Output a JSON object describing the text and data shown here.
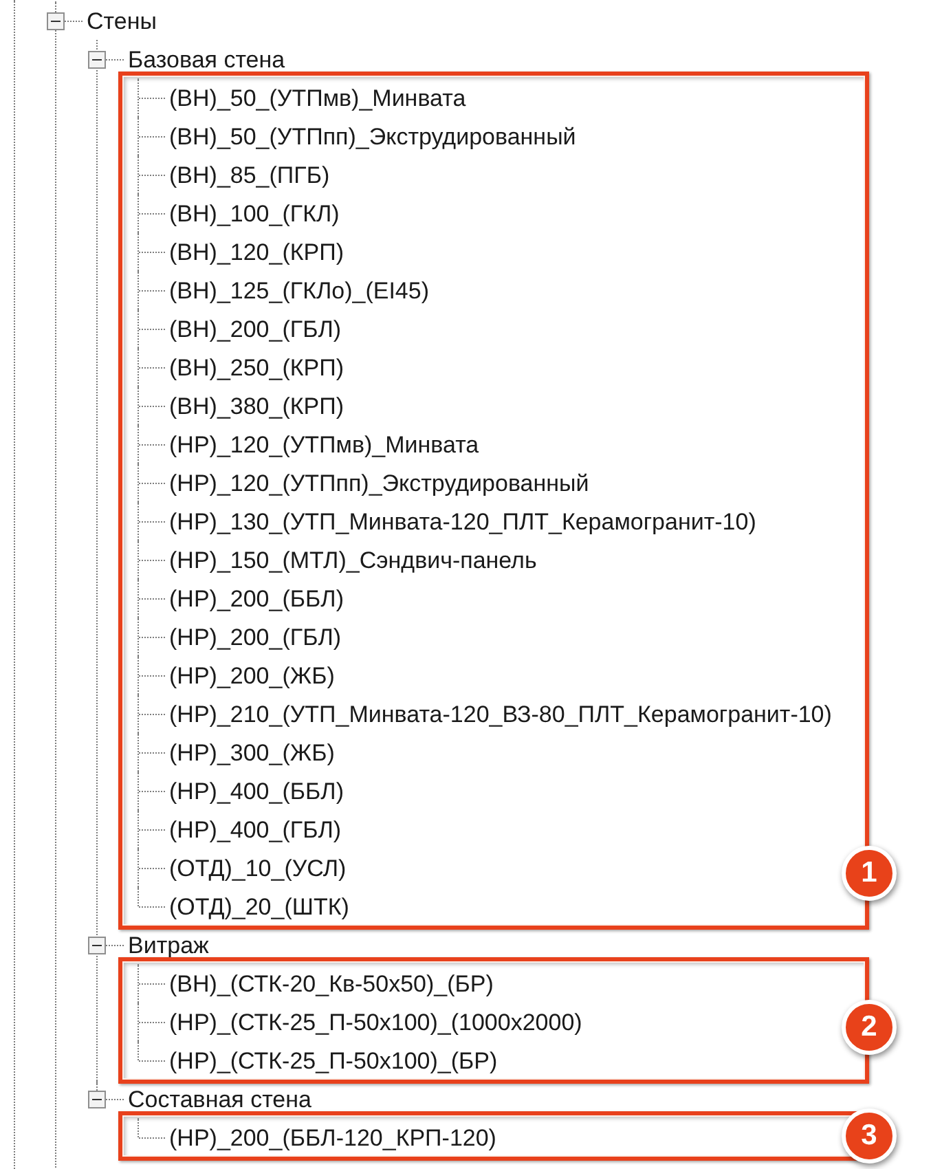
{
  "tree": [
    {
      "label": "Стены",
      "expanded": true,
      "children": [
        {
          "label": "Базовая стена",
          "expanded": true,
          "callout": "1",
          "children": [
            {
              "label": "(ВН)_50_(УТПмв)_Минвата"
            },
            {
              "label": "(ВН)_50_(УТПпп)_Экструдированный"
            },
            {
              "label": "(ВН)_85_(ПГБ)"
            },
            {
              "label": "(ВН)_100_(ГКЛ)"
            },
            {
              "label": "(ВН)_120_(КРП)"
            },
            {
              "label": "(ВН)_125_(ГКЛо)_(EI45)"
            },
            {
              "label": "(ВН)_200_(ГБЛ)"
            },
            {
              "label": "(ВН)_250_(КРП)"
            },
            {
              "label": "(ВН)_380_(КРП)"
            },
            {
              "label": "(НР)_120_(УТПмв)_Минвата"
            },
            {
              "label": "(НР)_120_(УТПпп)_Экструдированный"
            },
            {
              "label": "(НР)_130_(УТП_Минвата-120_ПЛТ_Керамогранит-10)"
            },
            {
              "label": "(НР)_150_(МТЛ)_Сэндвич-панель"
            },
            {
              "label": "(НР)_200_(ББЛ)"
            },
            {
              "label": "(НР)_200_(ГБЛ)"
            },
            {
              "label": "(НР)_200_(ЖБ)"
            },
            {
              "label": "(НР)_210_(УТП_Минвата-120_ВЗ-80_ПЛТ_Керамогранит-10)"
            },
            {
              "label": "(НР)_300_(ЖБ)"
            },
            {
              "label": "(НР)_400_(ББЛ)"
            },
            {
              "label": "(НР)_400_(ГБЛ)"
            },
            {
              "label": "(ОТД)_10_(УСЛ)"
            },
            {
              "label": "(ОТД)_20_(ШТК)"
            }
          ]
        },
        {
          "label": "Витраж",
          "expanded": true,
          "callout": "2",
          "children": [
            {
              "label": "(ВН)_(СТК-20_Кв-50x50)_(БР)"
            },
            {
              "label": "(НР)_(СТК-25_П-50x100)_(1000x2000)"
            },
            {
              "label": "(НР)_(СТК-25_П-50x100)_(БР)"
            }
          ]
        },
        {
          "label": "Составная стена",
          "expanded": true,
          "callout": "3",
          "children": [
            {
              "label": "(НР)_200_(ББЛ-120_КРП-120)"
            }
          ]
        }
      ]
    }
  ]
}
